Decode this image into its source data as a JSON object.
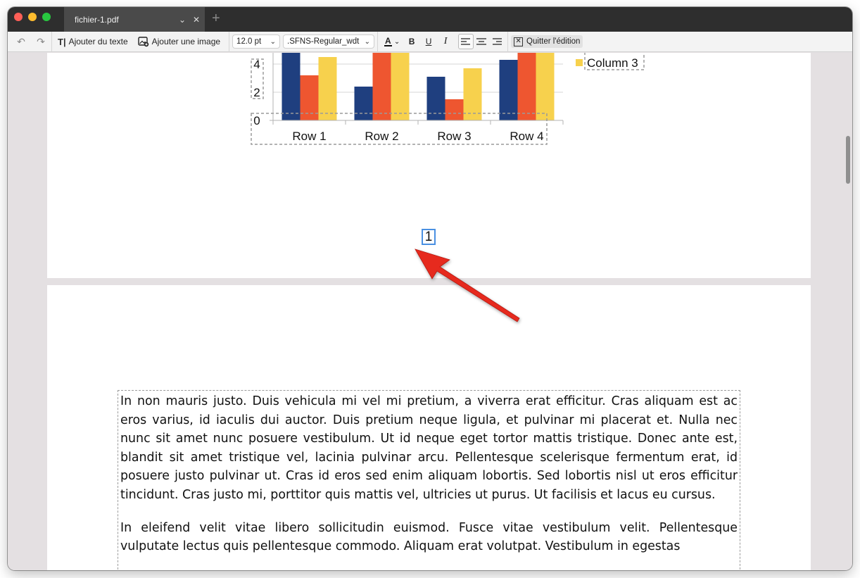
{
  "tab": {
    "title": "fichier-1.pdf"
  },
  "toolbar": {
    "add_text_label": "Ajouter du texte",
    "add_image_label": "Ajouter une image",
    "font_size": "12.0 pt",
    "font_name": ".SFNS-Regular_wdt",
    "bold": "B",
    "underline": "U",
    "italic": "I",
    "font_color_letter": "A",
    "exit_label": "Quitter l'édition"
  },
  "colors": {
    "series": [
      "#1f3f7f",
      "#ee5630",
      "#f7d14d"
    ],
    "selection": "#4a90e2",
    "arrow": "#e62a1e"
  },
  "page1": {
    "page_number": "1"
  },
  "chart_data": {
    "type": "bar",
    "categories": [
      "Row 1",
      "Row 2",
      "Row 3",
      "Row 4"
    ],
    "series": [
      {
        "name": "",
        "values": [
          9.1,
          2.4,
          3.1,
          4.3
        ]
      },
      {
        "name": "",
        "values": [
          3.2,
          8.8,
          1.5,
          9.0
        ]
      },
      {
        "name": "Column 3",
        "values": [
          4.5,
          9.5,
          3.7,
          6.2
        ]
      }
    ],
    "y_ticks": [
      "0",
      "2",
      "4"
    ],
    "legend_visible": [
      "Column 3"
    ],
    "legend_position": "right",
    "grid": true
  },
  "page2": {
    "paragraphs": [
      "In non mauris justo. Duis vehicula mi vel mi pretium, a viverra erat efficitur. Cras aliquam est ac eros varius, id iaculis dui auctor. Duis pretium neque ligula, et pulvinar mi placerat et. Nulla nec nunc sit amet nunc posuere vestibulum. Ut id neque eget tortor mattis tristique. Donec ante est, blandit sit amet tristique vel, lacinia pulvinar arcu. Pellentesque scelerisque fermentum erat, id posuere justo pulvinar ut. Cras id eros sed enim aliquam lobortis. Sed lobortis nisl ut eros efficitur tincidunt. Cras justo mi, porttitor quis mattis vel, ultricies ut purus. Ut facilisis et lacus eu cursus.",
      "In eleifend velit vitae libero sollicitudin euismod. Fusce vitae vestibulum velit. Pellentesque vulputate lectus quis pellentesque commodo. Aliquam erat volutpat. Vestibulum in egestas"
    ]
  }
}
